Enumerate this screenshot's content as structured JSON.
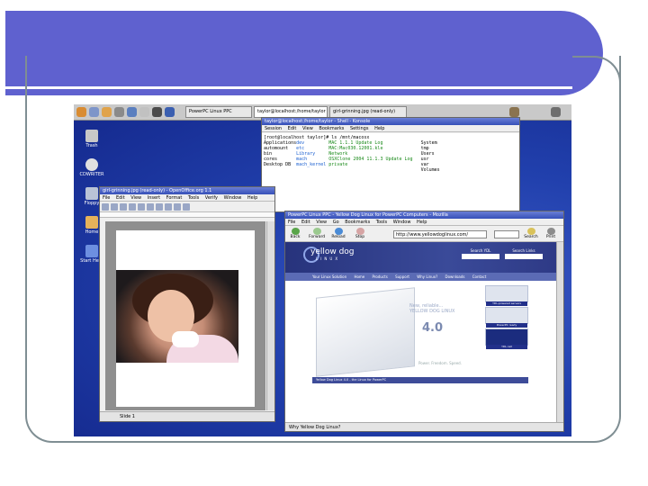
{
  "taskbar": {
    "tasks": [
      {
        "label": "PowerPC Linux PPC"
      },
      {
        "label": "taylor@localhost:/home/taylor - Shell - Konsole"
      },
      {
        "label": "girl-grinning.jpg (read-only)"
      }
    ]
  },
  "desktop_icons": [
    {
      "label": "Trash",
      "color": "#c8c8c8"
    },
    {
      "label": "CDWRITER",
      "color": "#e0e0e0"
    },
    {
      "label": "Floppy",
      "color": "#b9c3d6"
    },
    {
      "label": "Home",
      "color": "#e6b25a"
    },
    {
      "label": "Start Here",
      "color": "#6d8fe0"
    }
  ],
  "terminal": {
    "title": "taylor@localhost:/home/taylor - Shell - Konsole",
    "menu": [
      "Session",
      "Edit",
      "View",
      "Bookmarks",
      "Settings",
      "Help"
    ],
    "prompt": "[root@localhost taylor]# ls /mnt/macosx",
    "rows": [
      [
        "Applications",
        "dev",
        "MAC 1.1.1 Update Log",
        "System"
      ],
      [
        "automount",
        "etc",
        "MAC:Mac030.12001.kle",
        "tmp"
      ],
      [
        "bin",
        "Library",
        "Network",
        "Users"
      ],
      [
        "cores",
        "mach",
        "OSXClone 2004 11.1.3 Update Log",
        "usr"
      ],
      [
        "Desktop DB",
        "mach_kernel",
        "private",
        "var"
      ],
      [
        "",
        "",
        "",
        "Volumes"
      ]
    ]
  },
  "writer": {
    "title": "girl-grinning.jpg (read-only) - OpenOffice.org 1.1",
    "menu": [
      "File",
      "Edit",
      "View",
      "Insert",
      "Format",
      "Tools",
      "Verify",
      "Window",
      "Help"
    ],
    "status": "Slide 1"
  },
  "browser": {
    "title": "PowerPC Linux PPC - Yellow Dog Linux for PowerPC Computers - Mozilla",
    "menu": [
      "File",
      "Edit",
      "View",
      "Go",
      "Bookmarks",
      "Tools",
      "Window",
      "Help"
    ],
    "nav": [
      "Back",
      "Forward",
      "Reload",
      "Stop"
    ],
    "url": "http://www.yellowdoglinux.com/",
    "search_label": "Search",
    "print_label": "Print",
    "status": "Why Yellow Dog Linux?"
  },
  "yd_page": {
    "logo": "yellow dog",
    "logo_sub": "LINUX",
    "tagline": "Your Linux Solution",
    "search_labels": [
      "Search YDL",
      "Search Links"
    ],
    "nav": [
      "Home",
      "Products",
      "Support",
      "Why Linux?",
      "Downloads",
      "Contact"
    ],
    "hero_line1": "New, reliable...",
    "hero_line2": "YELLOW DOG LINUX",
    "version": "4.0",
    "hero_tag": "Power. Freedom. Speed.",
    "side": [
      "YDL-powered servers",
      "PowerPC ready",
      "YDL.net"
    ],
    "footer": "Yellow Dog Linux 4.0 - the Linux for PowerPC"
  }
}
